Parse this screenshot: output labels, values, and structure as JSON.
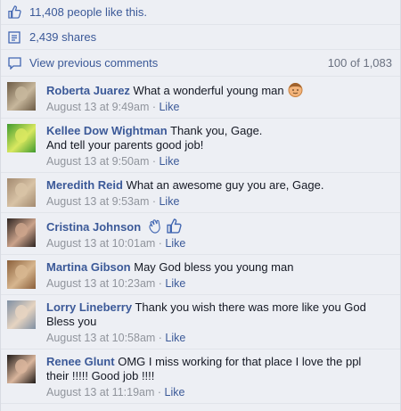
{
  "stats": {
    "likes": "11,408 people like this.",
    "shares": "2,439 shares",
    "view_previous": "View previous comments",
    "count": "100 of 1,083"
  },
  "like_label": "Like",
  "comments": [
    {
      "name": "Roberta Juarez",
      "text": "What a wonderful young man",
      "time": "August 13 at 9:49am",
      "avatar": "avatar-cat",
      "colors": [
        "#6b5a44",
        "#c7b79c"
      ]
    },
    {
      "name": "Kellee Dow Wightman",
      "text": "Thank you, Gage.",
      "text2": "And tell your parents good job!",
      "time": "August 13 at 9:50am",
      "avatar": "avatar-green-logo",
      "colors": [
        "#3f9a2e",
        "#d9e860"
      ]
    },
    {
      "name": "Meredith Reid",
      "text": "What an awesome guy you are, Gage.",
      "time": "August 13 at 9:53am",
      "avatar": "avatar-two-people",
      "colors": [
        "#a38a70",
        "#d8c3a6"
      ]
    },
    {
      "name": "Cristina Johnson",
      "text": "",
      "time": "August 13 at 10:01am",
      "avatar": "avatar-woman",
      "colors": [
        "#2e2421",
        "#cba38b"
      ]
    },
    {
      "name": "Martina Gibson",
      "text": "May God bless you young man",
      "time": "August 13 at 10:23am",
      "avatar": "avatar-dog",
      "colors": [
        "#8a5f3a",
        "#d7b68f"
      ]
    },
    {
      "name": "Lorry Lineberry",
      "text": "Thank you wish there was more like you God",
      "text2": "Bless you",
      "time": "August 13 at 10:58am",
      "avatar": "avatar-couple",
      "colors": [
        "#7e8fa3",
        "#e6d4c1"
      ]
    },
    {
      "name": "Renee Glunt",
      "text": "OMG I miss working for that place I love the ppl",
      "text2": "their !!!!! Good job !!!!",
      "time": "August 13 at 11:19am",
      "avatar": "avatar-woman-dark",
      "colors": [
        "#1f1a18",
        "#d9b59c"
      ]
    }
  ]
}
